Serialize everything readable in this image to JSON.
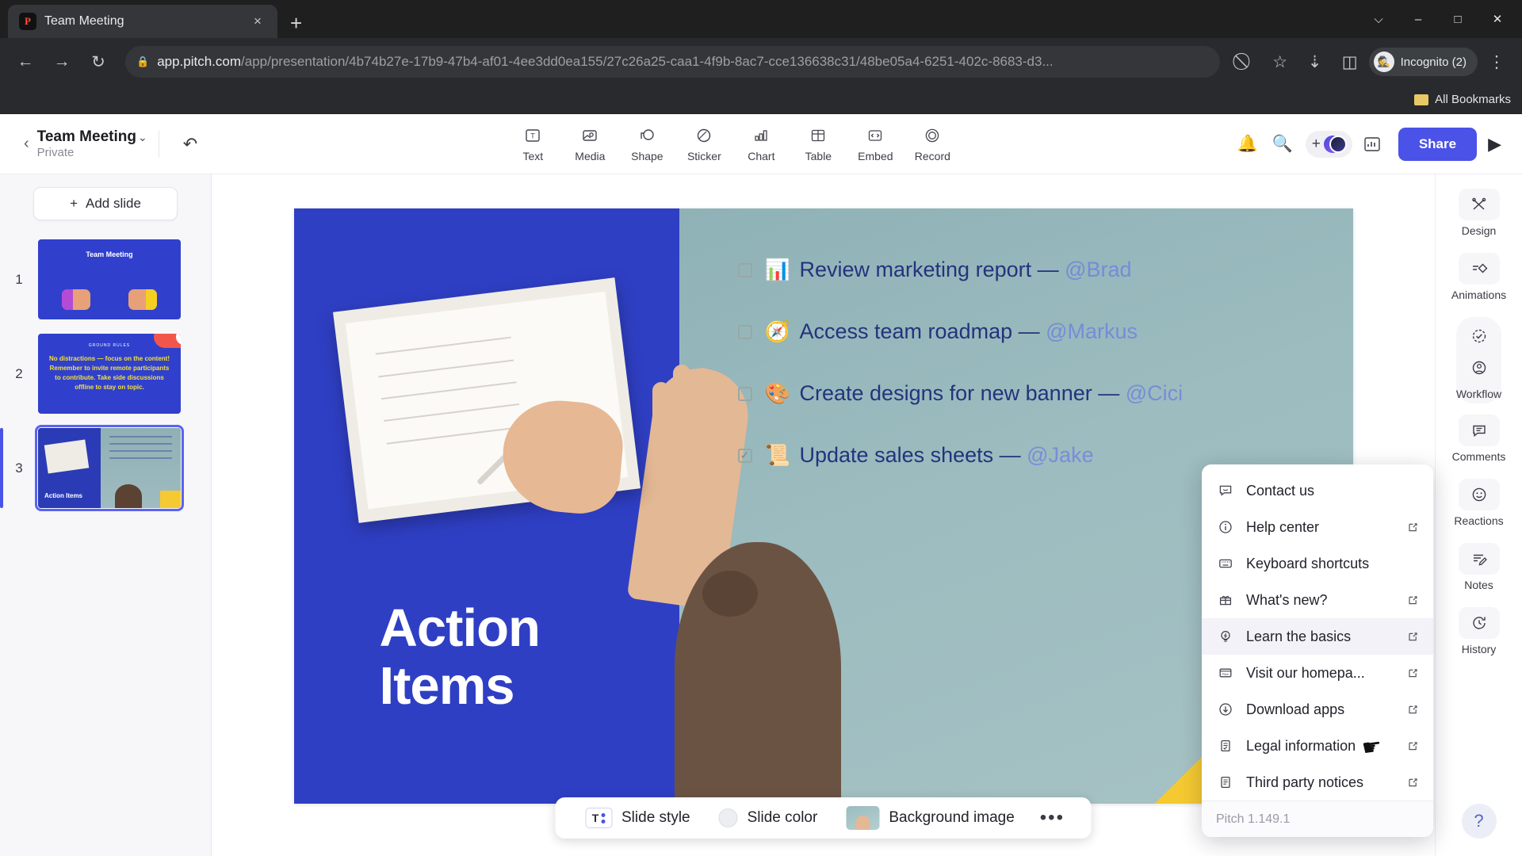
{
  "browser": {
    "tab": {
      "title": "Team Meeting",
      "favicon": "pitch-logo-icon",
      "close": "×"
    },
    "new_tab": "+",
    "window_controls": {
      "minimize": "–",
      "maximize": "□",
      "close": "✕",
      "chevron": "⌵"
    },
    "nav": {
      "back": "←",
      "forward": "→",
      "reload": "↻"
    },
    "omnibox": {
      "lock_icon": "lock-icon",
      "url_host": "app.pitch.com",
      "url_path": "/app/presentation/4b74b27e-17b9-47b4-af01-4ee3dd0ea155/27c26a25-caa1-4f9b-8ac7-cce136638c31/48be05a4-6251-402c-8683-d3..."
    },
    "toolbar_icons": {
      "hide_password": "⃠",
      "bookmark": "☆",
      "download": "⇣",
      "side_panel": "◫",
      "menu": "⋮"
    },
    "profile": {
      "label": "Incognito (2)",
      "avatar_icon": "incognito-icon"
    },
    "bookmarks_bar": {
      "folder_icon": "folder-icon",
      "label": "All Bookmarks"
    }
  },
  "app": {
    "topbar": {
      "back_icon": "chevron-left-icon",
      "deck_title": "Team Meeting",
      "deck_privacy": "Private",
      "title_chevron": "⌄",
      "undo_icon": "undo-icon",
      "tools": [
        {
          "label": "Text",
          "icon": "text-icon"
        },
        {
          "label": "Media",
          "icon": "media-icon"
        },
        {
          "label": "Shape",
          "icon": "shape-icon"
        },
        {
          "label": "Sticker",
          "icon": "sticker-icon"
        },
        {
          "label": "Chart",
          "icon": "chart-icon"
        },
        {
          "label": "Table",
          "icon": "table-icon"
        },
        {
          "label": "Embed",
          "icon": "embed-icon"
        },
        {
          "label": "Record",
          "icon": "record-icon"
        }
      ],
      "notifications_icon": "bell-icon",
      "search_icon": "search-icon",
      "add_icon": "plus-icon",
      "presenter_icon": "presenter-stats-icon",
      "share_label": "Share",
      "play_icon": "play-icon"
    },
    "left_panel": {
      "add_slide_label": "Add slide",
      "add_slide_icon": "plus-icon",
      "slides": [
        {
          "number": "1",
          "title": "Team Meeting",
          "selected": false
        },
        {
          "number": "2",
          "eyebrow": "GROUND RULES",
          "title": "No distractions — focus on the content! Remember to invite remote participants to contribute. Take side discussions offline to stay on topic.",
          "selected": false
        },
        {
          "number": "3",
          "title": "Action Items",
          "selected": true
        }
      ]
    },
    "slide": {
      "title_line1": "Action",
      "title_line2": "Items",
      "tasks": [
        {
          "checked": false,
          "emoji": "📊",
          "text": "Review marketing report — ",
          "mention": "@Brad"
        },
        {
          "checked": false,
          "emoji": "🧭",
          "text": "Access team roadmap — ",
          "mention": "@Markus"
        },
        {
          "checked": false,
          "emoji": "🎨",
          "text": "Create designs for new banner — ",
          "mention": "@Cici"
        },
        {
          "checked": true,
          "emoji": "📜",
          "text": "Update sales sheets — ",
          "mention": "@Jake"
        }
      ]
    },
    "bottom_bar": {
      "slide_style_label": "Slide style",
      "slide_style_icon": "text-style-icon",
      "slide_color_label": "Slide color",
      "slide_color_icon": "color-circle-icon",
      "background_image_label": "Background image",
      "background_image_icon": "background-thumbnail-icon",
      "more_label": "•••"
    },
    "right_rail": [
      {
        "label": "Design",
        "icon": "design-icon"
      },
      {
        "label": "Animations",
        "icon": "animations-icon"
      },
      {
        "label": "Workflow",
        "icon": "workflow-icon"
      },
      {
        "label": "Comments",
        "icon": "comments-icon"
      },
      {
        "label": "Reactions",
        "icon": "reactions-icon"
      },
      {
        "label": "Notes",
        "icon": "notes-icon"
      },
      {
        "label": "History",
        "icon": "history-icon"
      }
    ],
    "help_button_icon": "help-question-icon",
    "help_menu": {
      "items": [
        {
          "label": "Contact us",
          "icon": "chat-icon",
          "external": false
        },
        {
          "label": "Help center",
          "icon": "info-icon",
          "external": true
        },
        {
          "label": "Keyboard shortcuts",
          "icon": "keyboard-icon",
          "external": false
        },
        {
          "label": "What's new?",
          "icon": "gift-icon",
          "external": true
        },
        {
          "label": "Learn the basics",
          "icon": "lightbulb-icon",
          "external": true,
          "hovered": true
        },
        {
          "label": "Visit our homepa...",
          "icon": "pitch-card-icon",
          "external": true
        },
        {
          "label": "Download apps",
          "icon": "download-circle-icon",
          "external": true
        },
        {
          "label": "Legal information",
          "icon": "legal-doc-icon",
          "external": true
        },
        {
          "label": "Third party notices",
          "icon": "doc-icon",
          "external": true
        }
      ],
      "version": "Pitch 1.149.1",
      "external_glyph": "↗"
    }
  },
  "colors": {
    "accent": "#4a52e8",
    "slide_blue": "#2f3fc4",
    "slide_teal": "#9cbcbf",
    "yellow": "#f5c932",
    "chrome_dark": "#1f1f1f"
  }
}
